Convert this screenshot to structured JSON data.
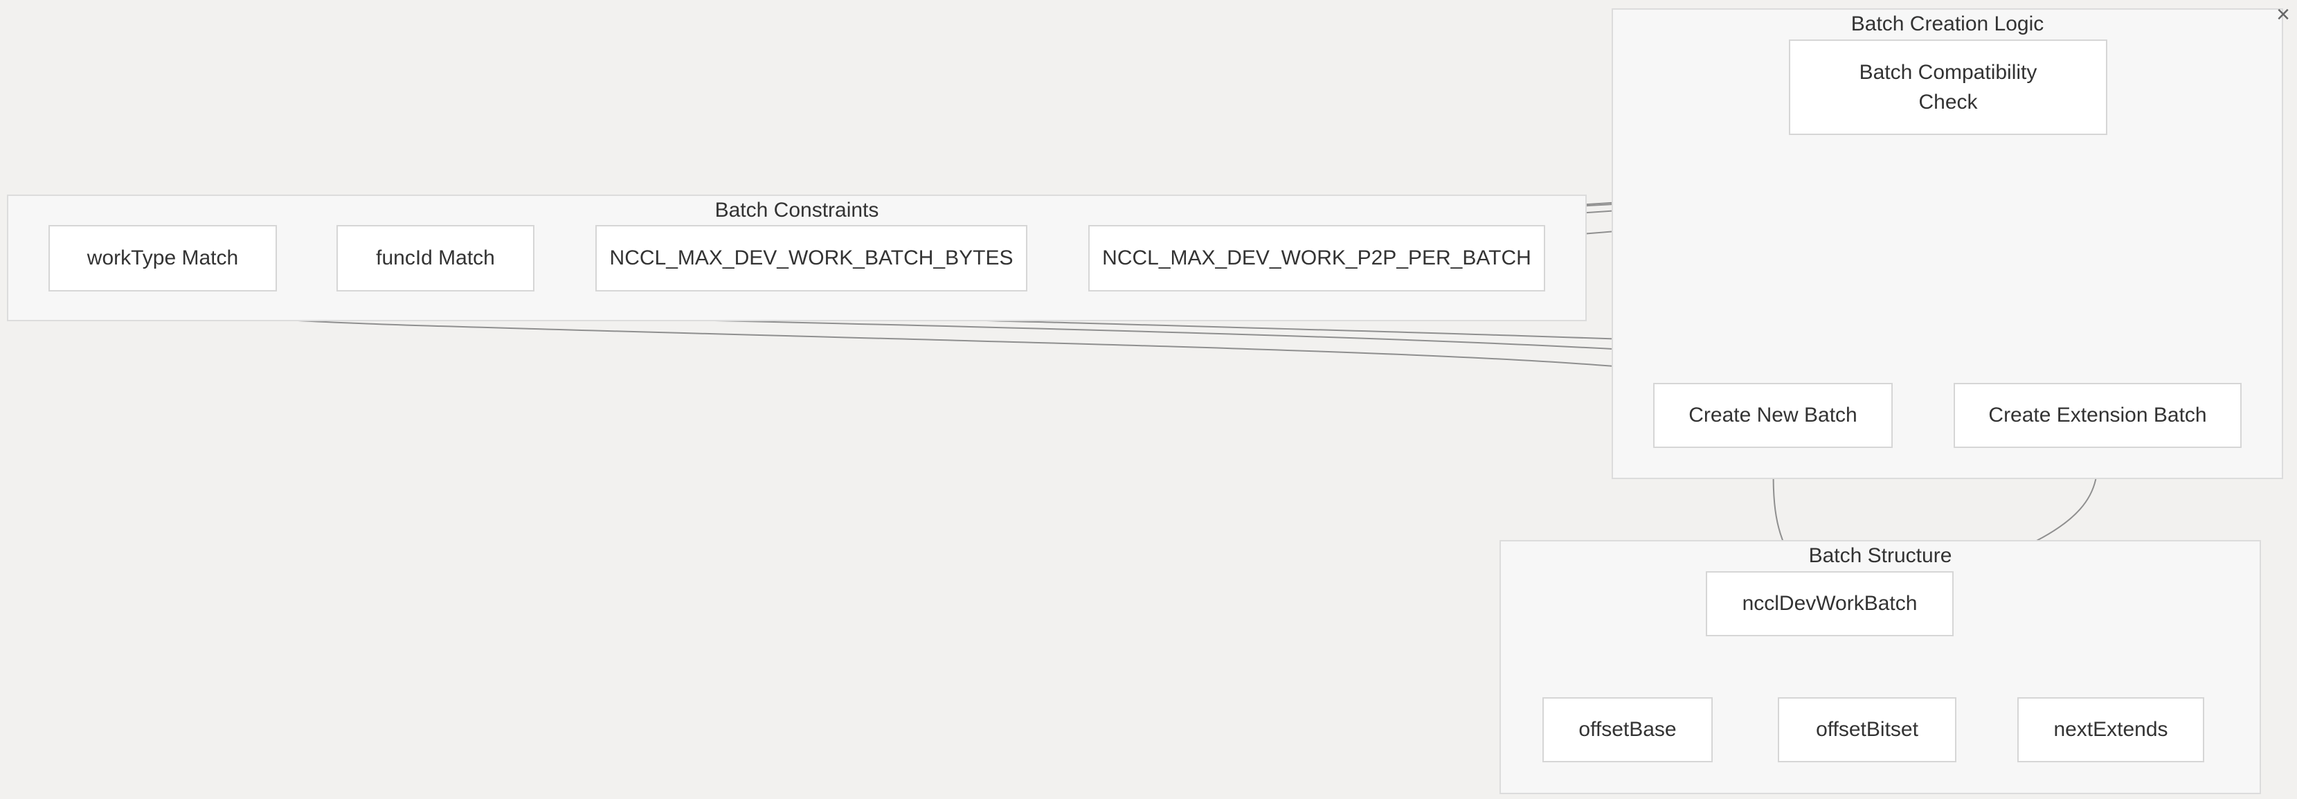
{
  "close_label": "×",
  "clusters": {
    "creation": {
      "title": "Batch Creation Logic"
    },
    "constraints": {
      "title": "Batch Constraints"
    },
    "structure": {
      "title": "Batch Structure"
    }
  },
  "nodes": {
    "compat_check": "Batch Compatibility Check",
    "worktype": "workType Match",
    "funcid": "funcId Match",
    "max_bytes": "NCCL_MAX_DEV_WORK_BATCH_BYTES",
    "max_p2p": "NCCL_MAX_DEV_WORK_P2P_PER_BATCH",
    "new_batch": "Create New Batch",
    "ext_batch": "Create Extension Batch",
    "devworkbatch": "ncclDevWorkBatch",
    "offsetbase": "offsetBase",
    "offsetbitset": "offsetBitset",
    "nextextends": "nextExtends"
  },
  "colors": {
    "background": "#f2f1ef",
    "cluster": "#f7f7f7",
    "node": "#ffffff",
    "edge": "#8f8f8f"
  }
}
